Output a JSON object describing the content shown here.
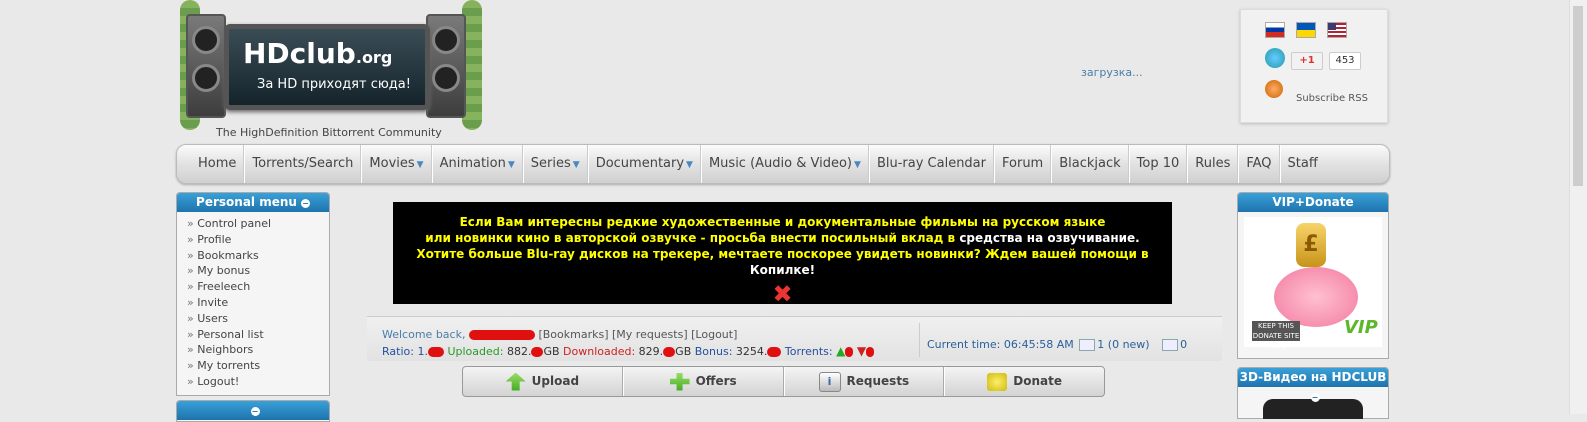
{
  "header": {
    "logo_brand": "HDclub",
    "logo_domain": ".org",
    "logo_slogan": "За HD приходят сюда!",
    "tagline": "The HighDefinition Bittorrent Community",
    "loading_text": "загрузка...",
    "gplus_label": "+1",
    "gplus_count": "453",
    "rss_label": "Subscribe RSS"
  },
  "nav": [
    {
      "label": "Home",
      "dropdown": false
    },
    {
      "label": "Torrents/Search",
      "dropdown": false
    },
    {
      "label": "Movies",
      "dropdown": true
    },
    {
      "label": "Animation",
      "dropdown": true
    },
    {
      "label": "Series",
      "dropdown": true
    },
    {
      "label": "Documentary",
      "dropdown": true
    },
    {
      "label": "Music (Audio & Video)",
      "dropdown": true
    },
    {
      "label": "Blu-ray Calendar",
      "dropdown": false
    },
    {
      "label": "Forum",
      "dropdown": false
    },
    {
      "label": "Blackjack",
      "dropdown": false
    },
    {
      "label": "Top 10",
      "dropdown": false
    },
    {
      "label": "Rules",
      "dropdown": false
    },
    {
      "label": "FAQ",
      "dropdown": false
    },
    {
      "label": "Staff",
      "dropdown": false
    }
  ],
  "personal_menu": {
    "title": "Personal menu",
    "items": [
      "Control panel",
      "Profile",
      "Bookmarks",
      "My bonus",
      "Freeleech",
      "Invite",
      "Users",
      "Personal list",
      "Neighbors",
      "My torrents",
      "Logout!"
    ]
  },
  "banner": {
    "line1": "Если Вам интересны редкие художественные и документальные фильмы на русском языке",
    "line2a": "или новинки кино в авторской озвучке - просьба внести посильный вклад в ",
    "line2b": "средства на озвучивание.",
    "line3a": "Хотите больше Blu-ray дисков на трекере, мечтаете поскорее увидеть новинки? Ждем вашей помощи в ",
    "line3b": "Копилке!",
    "close_glyph": "✖"
  },
  "userbar": {
    "welcome": "Welcome back,",
    "bookmarks": "[Bookmarks]",
    "requests": "[My requests]",
    "logout": "[Logout]",
    "ratio_label": "Ratio:",
    "ratio_value": "1.",
    "uploaded_label": "Uploaded:",
    "uploaded_value": "882.",
    "uploaded_unit": "GB",
    "downloaded_label": "Downloaded:",
    "downloaded_value": "829.",
    "downloaded_unit": "GB",
    "bonus_label": "Bonus:",
    "bonus_value": "3254.",
    "torrents_label": "Torrents:",
    "current_time": "Current time: 06:45:58 AM",
    "messages": "1 (0 new)",
    "sent": "0"
  },
  "actions": [
    "Upload",
    "Offers",
    "Requests",
    "Donate"
  ],
  "right_panels": {
    "vip_title": "VIP+Donate",
    "vip_badge": "KEEP THIS DONATE SITE ALIVE",
    "vip_text": "VIP",
    "coin_symbol": "£",
    "video3d_title": "3D-Видео на HDCLUB"
  },
  "colors": {
    "panel_header": "#1e73ad",
    "banner_text": "#ffff00",
    "uploaded": "#2a9a2a",
    "downloaded": "#cc2222",
    "link": "#4a7ea8"
  }
}
